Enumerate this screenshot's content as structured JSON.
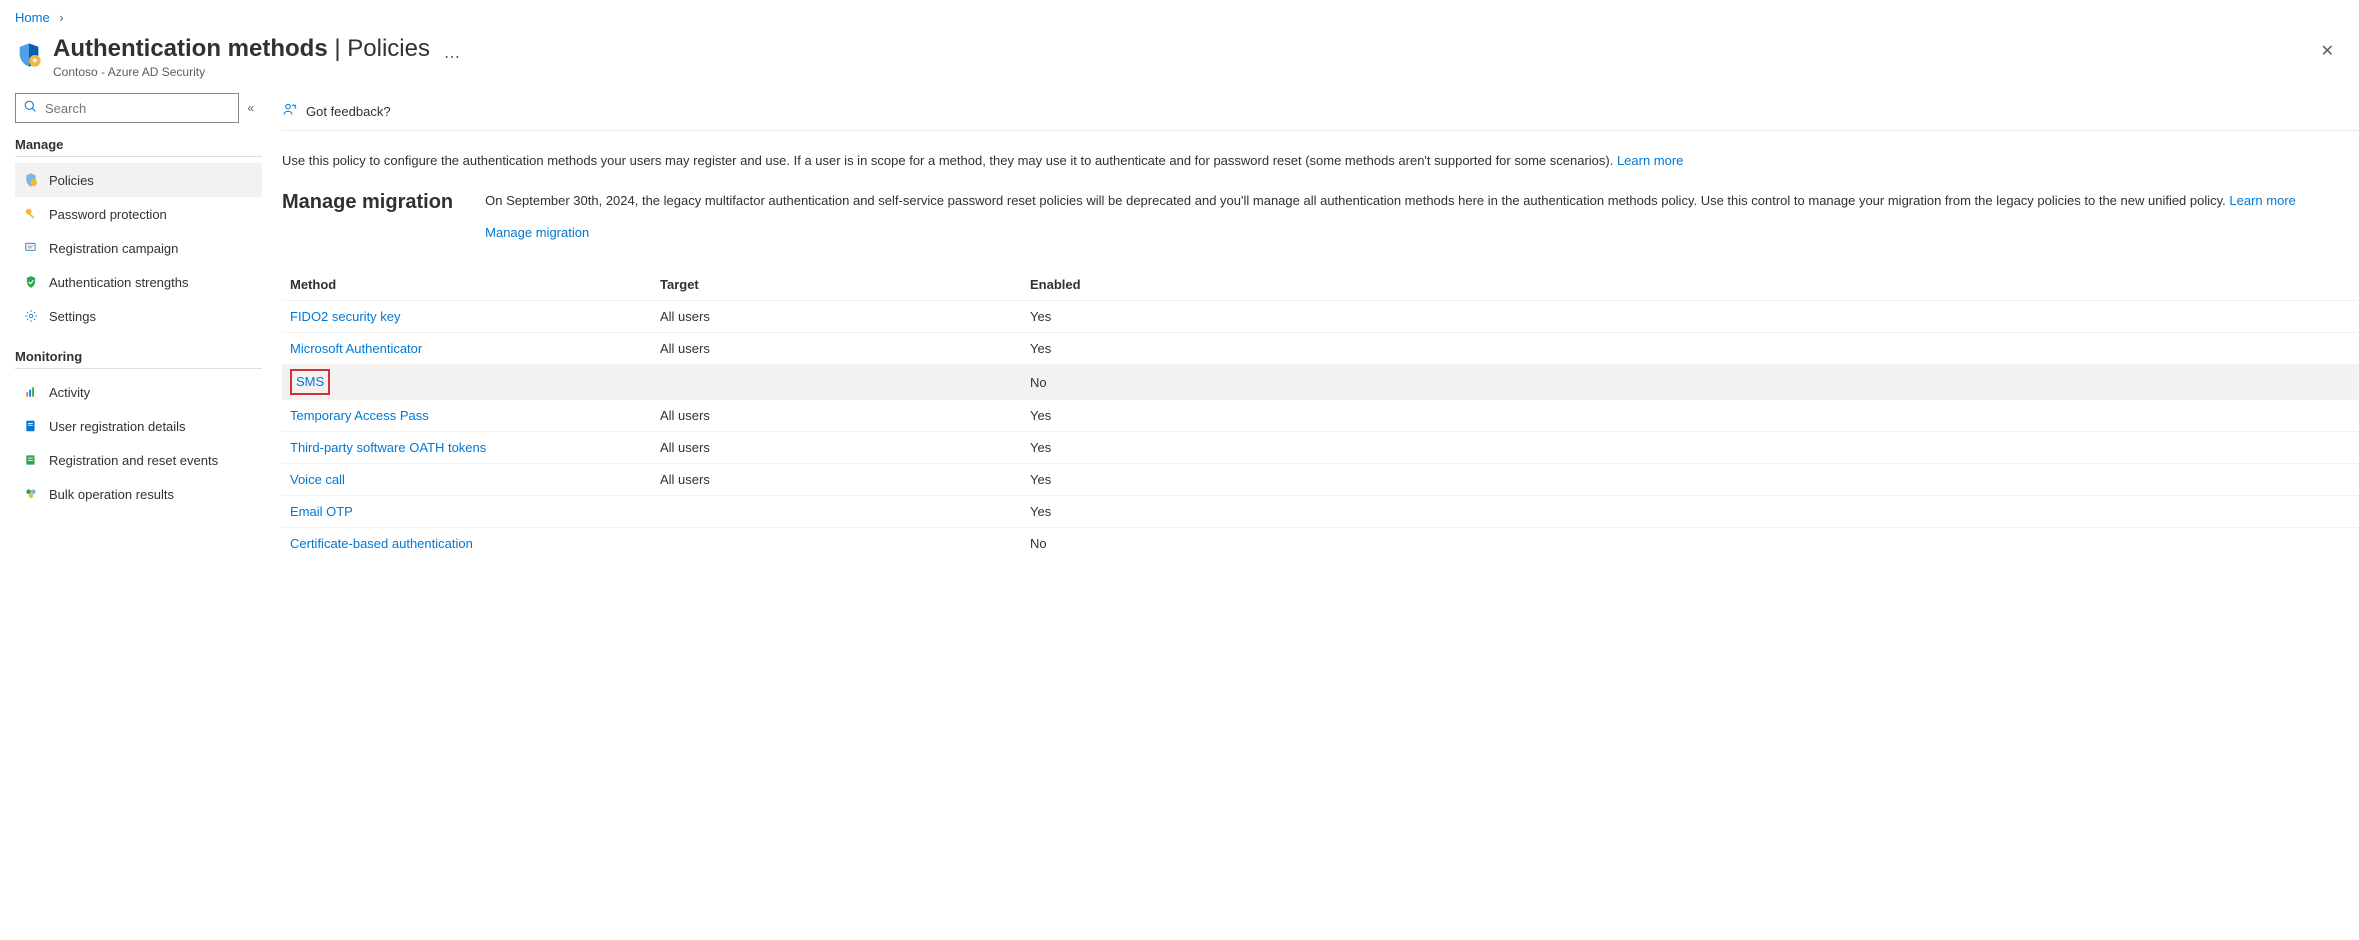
{
  "breadcrumb": {
    "home": "Home"
  },
  "header": {
    "title_bold": "Authentication methods",
    "title_sep": " | ",
    "title_thin": "Policies",
    "subtitle": "Contoso - Azure AD Security"
  },
  "search": {
    "placeholder": "Search"
  },
  "sidebar": {
    "section_manage": "Manage",
    "section_monitoring": "Monitoring",
    "manage_items": [
      {
        "label": "Policies",
        "icon": "policies",
        "selected": true
      },
      {
        "label": "Password protection",
        "icon": "key",
        "selected": false
      },
      {
        "label": "Registration campaign",
        "icon": "campaign",
        "selected": false
      },
      {
        "label": "Authentication strengths",
        "icon": "shield-ok",
        "selected": false
      },
      {
        "label": "Settings",
        "icon": "gear",
        "selected": false
      }
    ],
    "monitoring_items": [
      {
        "label": "Activity",
        "icon": "activity"
      },
      {
        "label": "User registration details",
        "icon": "book"
      },
      {
        "label": "Registration and reset events",
        "icon": "list"
      },
      {
        "label": "Bulk operation results",
        "icon": "bulk"
      }
    ]
  },
  "toolbar": {
    "feedback": "Got feedback?"
  },
  "intro": {
    "text": "Use this policy to configure the authentication methods your users may register and use. If a user is in scope for a method, they may use it to authenticate and for password reset (some methods aren't supported for some scenarios). ",
    "learn_more": "Learn more"
  },
  "migration": {
    "heading": "Manage migration",
    "text": "On September 30th, 2024, the legacy multifactor authentication and self-service password reset policies will be deprecated and you'll manage all authentication methods here in the authentication methods policy. Use this control to manage your migration from the legacy policies to the new unified policy. ",
    "learn_more": "Learn more",
    "manage_link": "Manage migration"
  },
  "table": {
    "columns": {
      "method": "Method",
      "target": "Target",
      "enabled": "Enabled"
    },
    "rows": [
      {
        "method": "FIDO2 security key",
        "target": "All users",
        "enabled": "Yes",
        "highlight": false,
        "boxed": false
      },
      {
        "method": "Microsoft Authenticator",
        "target": "All users",
        "enabled": "Yes",
        "highlight": false,
        "boxed": false
      },
      {
        "method": "SMS",
        "target": "",
        "enabled": "No",
        "highlight": true,
        "boxed": true
      },
      {
        "method": "Temporary Access Pass",
        "target": "All users",
        "enabled": "Yes",
        "highlight": false,
        "boxed": false
      },
      {
        "method": "Third-party software OATH tokens",
        "target": "All users",
        "enabled": "Yes",
        "highlight": false,
        "boxed": false
      },
      {
        "method": "Voice call",
        "target": "All users",
        "enabled": "Yes",
        "highlight": false,
        "boxed": false
      },
      {
        "method": "Email OTP",
        "target": "",
        "enabled": "Yes",
        "highlight": false,
        "boxed": false
      },
      {
        "method": "Certificate-based authentication",
        "target": "",
        "enabled": "No",
        "highlight": false,
        "boxed": false
      }
    ]
  }
}
